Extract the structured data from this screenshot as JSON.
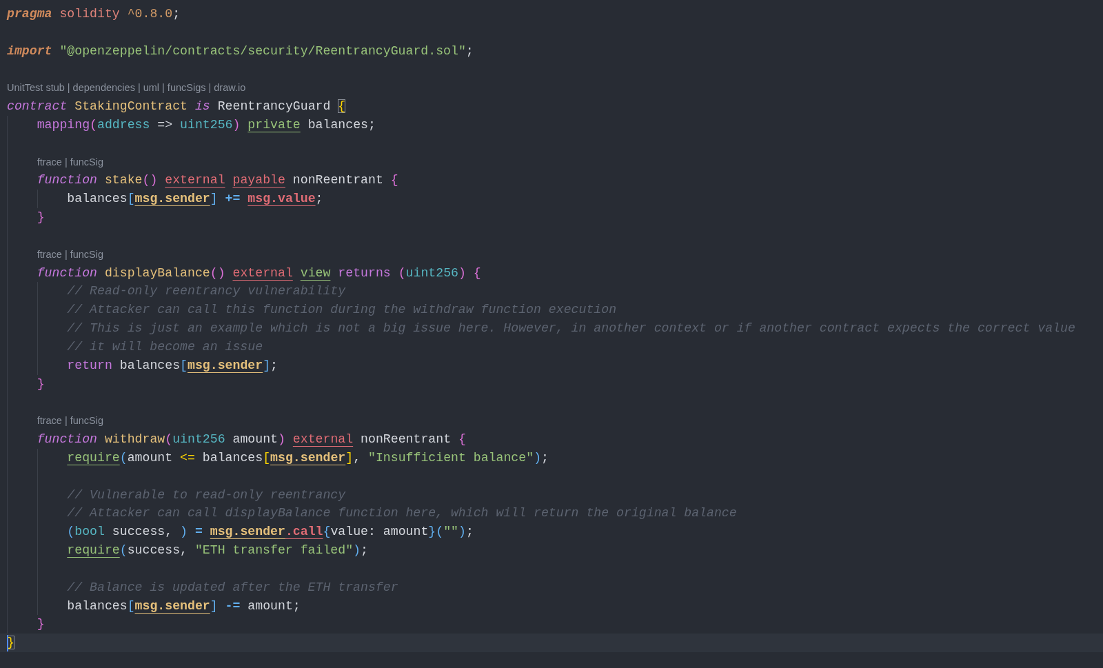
{
  "lens_separator": "|",
  "lines": [
    {
      "kind": "code",
      "tokens": [
        {
          "text": "pragma",
          "kind": "directive"
        },
        {
          "text": "solidity",
          "kind": "pragma-name",
          "gap": true
        },
        {
          "text": "^0.8.0",
          "kind": "number",
          "gap": true
        },
        {
          "text": ";",
          "kind": "plain"
        }
      ]
    },
    {
      "kind": "blank"
    },
    {
      "kind": "code",
      "tokens": [
        {
          "text": "import",
          "kind": "directive"
        },
        {
          "text": "\"@openzeppelin/contracts/security/ReentrancyGuard.sol\"",
          "kind": "string",
          "gap": true
        },
        {
          "text": ";",
          "kind": "plain"
        }
      ]
    },
    {
      "kind": "blank"
    },
    {
      "kind": "lens",
      "links": [
        "UnitTest stub",
        "dependencies",
        "uml",
        "funcSigs",
        "draw.io"
      ]
    },
    {
      "kind": "code",
      "tokens": [
        {
          "text": "contract",
          "kind": "keyword"
        },
        {
          "text": "StakingContract",
          "kind": "name",
          "gap": true
        },
        {
          "text": "is",
          "kind": "keyword",
          "gap": true
        },
        {
          "text": "ReentrancyGuard",
          "kind": "plain",
          "gap": true
        },
        {
          "text": "{",
          "kind": "bracket1",
          "matched": true,
          "gap": true
        }
      ],
      "children": [
        {
          "kind": "code",
          "tokens": [
            {
              "text": "mapping",
              "kind": "builtin"
            },
            {
              "text": "(",
              "kind": "bracket2"
            },
            {
              "text": "address",
              "kind": "type"
            },
            {
              "text": "=>",
              "kind": "plain",
              "gap": true
            },
            {
              "text": "uint256",
              "kind": "type",
              "gap": true
            },
            {
              "text": ")",
              "kind": "bracket2"
            },
            {
              "text": "private",
              "kind": "modifier-green",
              "gap": true
            },
            {
              "text": "balances;",
              "kind": "plain",
              "gap": true
            }
          ]
        },
        {
          "kind": "blank"
        },
        {
          "kind": "lens",
          "links": [
            "ftrace",
            "funcSig"
          ]
        },
        {
          "kind": "code",
          "tokens": [
            {
              "text": "function",
              "kind": "keyword"
            },
            {
              "text": "stake",
              "kind": "name",
              "gap": true
            },
            {
              "text": "()",
              "kind": "bracket2"
            },
            {
              "text": "external",
              "kind": "modifier-red",
              "gap": true
            },
            {
              "text": "payable",
              "kind": "modifier-red",
              "gap": true
            },
            {
              "text": "nonReentrant",
              "kind": "plain",
              "gap": true
            },
            {
              "text": "{",
              "kind": "bracket2",
              "gap": true
            }
          ],
          "children": [
            {
              "kind": "code",
              "tokens": [
                {
                  "text": "balances",
                  "kind": "plain"
                },
                {
                  "text": "[",
                  "kind": "bracket3"
                },
                {
                  "text": "msg.sender",
                  "kind": "member"
                },
                {
                  "text": "]",
                  "kind": "bracket3"
                },
                {
                  "text": "+=",
                  "kind": "operator",
                  "gap": true
                },
                {
                  "text": "msg.value",
                  "kind": "member-red",
                  "gap": true
                },
                {
                  "text": ";",
                  "kind": "plain"
                }
              ]
            }
          ]
        },
        {
          "kind": "code",
          "tokens": [
            {
              "text": "}",
              "kind": "bracket2"
            }
          ]
        },
        {
          "kind": "blank"
        },
        {
          "kind": "lens",
          "links": [
            "ftrace",
            "funcSig"
          ]
        },
        {
          "kind": "code",
          "tokens": [
            {
              "text": "function",
              "kind": "keyword"
            },
            {
              "text": "displayBalance",
              "kind": "name",
              "gap": true
            },
            {
              "text": "()",
              "kind": "bracket2"
            },
            {
              "text": "external",
              "kind": "modifier-red",
              "gap": true
            },
            {
              "text": "view",
              "kind": "modifier-green",
              "gap": true
            },
            {
              "text": "returns",
              "kind": "builtin",
              "gap": true
            },
            {
              "text": "(",
              "kind": "bracket2",
              "gap": true
            },
            {
              "text": "uint256",
              "kind": "type"
            },
            {
              "text": ")",
              "kind": "bracket2"
            },
            {
              "text": "{",
              "kind": "bracket2",
              "gap": true
            }
          ],
          "children": [
            {
              "kind": "code",
              "tokens": [
                {
                  "text": "// Read-only reentrancy vulnerability",
                  "kind": "comment"
                }
              ]
            },
            {
              "kind": "code",
              "tokens": [
                {
                  "text": "// Attacker can call this function during the withdraw function execution",
                  "kind": "comment"
                }
              ]
            },
            {
              "kind": "code",
              "tokens": [
                {
                  "text": "// This is just an example which is not a big issue here. However, in another context or if another contract expects the correct value",
                  "kind": "comment"
                }
              ]
            },
            {
              "kind": "code",
              "tokens": [
                {
                  "text": "// it will become an issue",
                  "kind": "comment"
                }
              ]
            },
            {
              "kind": "code",
              "tokens": [
                {
                  "text": "return",
                  "kind": "builtin"
                },
                {
                  "text": "balances",
                  "kind": "plain",
                  "gap": true
                },
                {
                  "text": "[",
                  "kind": "bracket3"
                },
                {
                  "text": "msg.sender",
                  "kind": "member"
                },
                {
                  "text": "]",
                  "kind": "bracket3"
                },
                {
                  "text": ";",
                  "kind": "plain"
                }
              ]
            }
          ]
        },
        {
          "kind": "code",
          "tokens": [
            {
              "text": "}",
              "kind": "bracket2"
            }
          ]
        },
        {
          "kind": "blank"
        },
        {
          "kind": "lens",
          "links": [
            "ftrace",
            "funcSig"
          ]
        },
        {
          "kind": "code",
          "tokens": [
            {
              "text": "function",
              "kind": "keyword"
            },
            {
              "text": "withdraw",
              "kind": "name",
              "gap": true
            },
            {
              "text": "(",
              "kind": "bracket2"
            },
            {
              "text": "uint256",
              "kind": "type"
            },
            {
              "text": "amount",
              "kind": "plain",
              "gap": true
            },
            {
              "text": ")",
              "kind": "bracket2"
            },
            {
              "text": "external",
              "kind": "modifier-red",
              "gap": true
            },
            {
              "text": "nonReentrant",
              "kind": "plain",
              "gap": true
            },
            {
              "text": "{",
              "kind": "bracket2",
              "gap": true
            }
          ],
          "children": [
            {
              "kind": "code",
              "tokens": [
                {
                  "text": "require",
                  "kind": "modifier-green"
                },
                {
                  "text": "(",
                  "kind": "bracket3"
                },
                {
                  "text": "amount",
                  "kind": "plain"
                },
                {
                  "text": "<=",
                  "kind": "bracket1",
                  "gap": true
                },
                {
                  "text": "balances",
                  "kind": "plain",
                  "gap": true
                },
                {
                  "text": "[",
                  "kind": "bracket1"
                },
                {
                  "text": "msg.sender",
                  "kind": "member"
                },
                {
                  "text": "]",
                  "kind": "bracket1"
                },
                {
                  "text": ",",
                  "kind": "plain"
                },
                {
                  "text": "\"Insufficient balance\"",
                  "kind": "string",
                  "gap": true
                },
                {
                  "text": ")",
                  "kind": "bracket3"
                },
                {
                  "text": ";",
                  "kind": "plain"
                }
              ]
            },
            {
              "kind": "blank"
            },
            {
              "kind": "code",
              "tokens": [
                {
                  "text": "// Vulnerable to read-only reentrancy",
                  "kind": "comment"
                }
              ]
            },
            {
              "kind": "code",
              "tokens": [
                {
                  "text": "// Attacker can call displayBalance function here, which will return the original balance",
                  "kind": "comment"
                }
              ]
            },
            {
              "kind": "code",
              "tokens": [
                {
                  "text": "(",
                  "kind": "bracket3"
                },
                {
                  "text": "bool",
                  "kind": "type"
                },
                {
                  "text": "success,",
                  "kind": "plain",
                  "gap": true
                },
                {
                  "text": ")",
                  "kind": "bracket3",
                  "gap": true
                },
                {
                  "text": "=",
                  "kind": "operator",
                  "gap": true
                },
                {
                  "text": "msg.sender",
                  "kind": "member",
                  "gap": true
                },
                {
                  "text": ".call",
                  "kind": "member-red"
                },
                {
                  "text": "{",
                  "kind": "bracket3"
                },
                {
                  "text": "value: amount",
                  "kind": "plain"
                },
                {
                  "text": "}",
                  "kind": "bracket3"
                },
                {
                  "text": "(",
                  "kind": "bracket3"
                },
                {
                  "text": "\"\"",
                  "kind": "string"
                },
                {
                  "text": ")",
                  "kind": "bracket3"
                },
                {
                  "text": ";",
                  "kind": "plain"
                }
              ]
            },
            {
              "kind": "code",
              "tokens": [
                {
                  "text": "require",
                  "kind": "modifier-green"
                },
                {
                  "text": "(",
                  "kind": "bracket3"
                },
                {
                  "text": "success,",
                  "kind": "plain"
                },
                {
                  "text": "\"ETH transfer failed\"",
                  "kind": "string",
                  "gap": true
                },
                {
                  "text": ")",
                  "kind": "bracket3"
                },
                {
                  "text": ";",
                  "kind": "plain"
                }
              ]
            },
            {
              "kind": "blank"
            },
            {
              "kind": "code",
              "tokens": [
                {
                  "text": "// Balance is updated after the ETH transfer",
                  "kind": "comment"
                }
              ]
            },
            {
              "kind": "code",
              "tokens": [
                {
                  "text": "balances",
                  "kind": "plain"
                },
                {
                  "text": "[",
                  "kind": "bracket3"
                },
                {
                  "text": "msg.sender",
                  "kind": "member"
                },
                {
                  "text": "]",
                  "kind": "bracket3"
                },
                {
                  "text": "-=",
                  "kind": "operator",
                  "gap": true
                },
                {
                  "text": "amount;",
                  "kind": "plain",
                  "gap": true
                }
              ]
            }
          ]
        },
        {
          "kind": "code",
          "tokens": [
            {
              "text": "}",
              "kind": "bracket2"
            }
          ]
        }
      ]
    },
    {
      "kind": "code",
      "current": true,
      "cursor": true,
      "tokens": [
        {
          "text": "}",
          "kind": "bracket1",
          "matched": true
        }
      ]
    }
  ]
}
